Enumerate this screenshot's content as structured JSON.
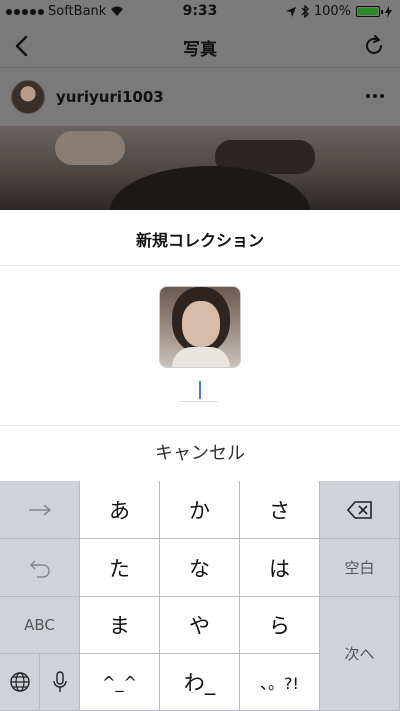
{
  "status_bar": {
    "carrier": "SoftBank",
    "time": "9:33",
    "battery": "100%"
  },
  "nav": {
    "title": "写真"
  },
  "post": {
    "username": "yuriyuri1003"
  },
  "modal": {
    "title": "新規コレクション",
    "input_value": "",
    "cancel_label": "キャンセル"
  },
  "keyboard": {
    "row1": [
      "あ",
      "か",
      "さ"
    ],
    "row2": [
      "た",
      "な",
      "は"
    ],
    "row3": [
      "ま",
      "や",
      "ら"
    ],
    "row4": [
      "^_^",
      "わ_",
      "、。?!"
    ],
    "abc_label": "ABC",
    "space_label": "空白",
    "next_label": "次へ"
  }
}
